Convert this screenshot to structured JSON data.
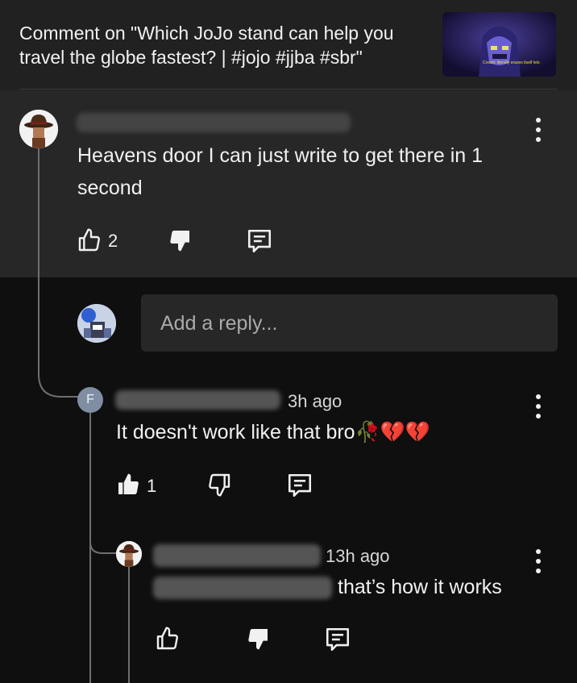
{
  "header": {
    "title": "Comment on \"Which JoJo stand can help you travel the globe fastest? | #jojo #jjba #sbr\"",
    "thumbnail_caption": "Cream: literally erases itself lets"
  },
  "top_comment": {
    "text": "Heavens door I can just write to get there in 1 second",
    "like_count": "2",
    "avatar_icon": "fedora-avatar-icon"
  },
  "reply_input": {
    "placeholder": "Add a reply..."
  },
  "reply1": {
    "avatar_letter": "F",
    "time": "3h ago",
    "text": "It doesn't work like that bro",
    "emojis": "🥀💔💔",
    "like_count": "1"
  },
  "reply2": {
    "time": "13h ago",
    "text": "that’s how it works"
  },
  "colors": {
    "header_bg": "#212121",
    "comment_bg": "#272727",
    "page_bg": "#0f0f0f",
    "text": "#f1f1f1",
    "avatar_f": "#7f8ea3"
  }
}
